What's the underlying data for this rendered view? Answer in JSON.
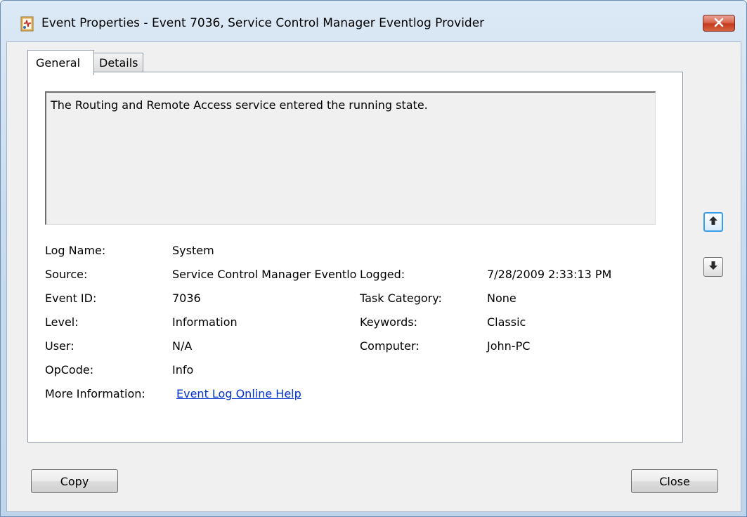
{
  "window": {
    "title": "Event Properties - Event 7036, Service Control Manager Eventlog Provider"
  },
  "tabs": [
    {
      "label": "General",
      "selected": true
    },
    {
      "label": "Details",
      "selected": false
    }
  ],
  "description": "The Routing and Remote Access service entered the running state.",
  "fields": {
    "log_name": {
      "label": "Log Name:",
      "value": "System"
    },
    "source": {
      "label": "Source:",
      "value": "Service Control Manager Eventlog Provider"
    },
    "logged": {
      "label": "Logged:",
      "value": "7/28/2009 2:33:13 PM"
    },
    "event_id": {
      "label": "Event ID:",
      "value": "7036"
    },
    "task_category": {
      "label": "Task Category:",
      "value": "None"
    },
    "level": {
      "label": "Level:",
      "value": "Information"
    },
    "keywords": {
      "label": "Keywords:",
      "value": "Classic"
    },
    "user": {
      "label": "User:",
      "value": "N/A"
    },
    "computer": {
      "label": "Computer:",
      "value": "John-PC"
    },
    "opcode": {
      "label": "OpCode:",
      "value": "Info"
    },
    "more_information": {
      "label": "More Information:",
      "link": "Event Log Online Help"
    }
  },
  "buttons": {
    "copy": "Copy",
    "close": "Close"
  },
  "icons": {
    "title": "event-viewer-icon",
    "close": "close-x-icon",
    "up": "arrow-up-icon",
    "down": "arrow-down-icon"
  },
  "colors": {
    "link": "#0033cc",
    "close_button": "#c53a1f",
    "up_button_border": "#3a9ee6"
  }
}
